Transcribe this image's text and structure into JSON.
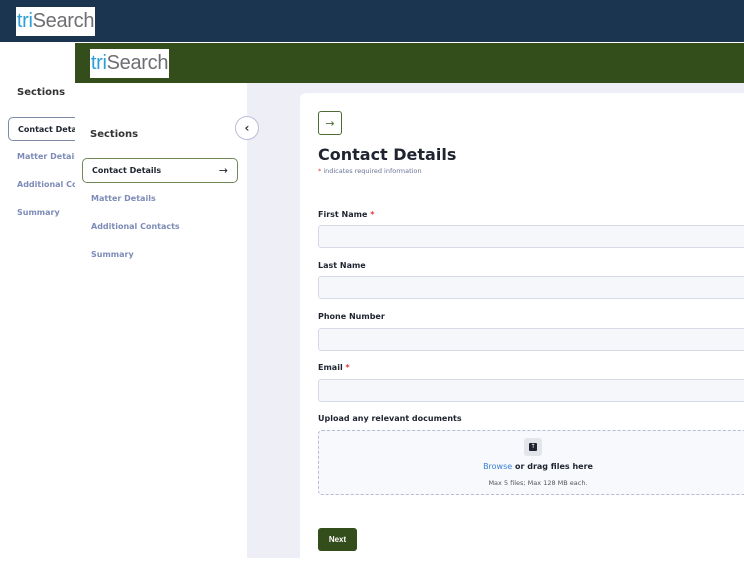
{
  "brand": {
    "logo_tri": "tri",
    "logo_search": "Search",
    "colors": {
      "back_header": "#1b344f",
      "front_header": "#334d1b",
      "accent": "#334d1b"
    }
  },
  "back_sidebar": {
    "title": "Sections",
    "items": [
      {
        "label": "Contact Details",
        "active": true
      },
      {
        "label": "Matter Details"
      },
      {
        "label": "Additional Contacts"
      },
      {
        "label": "Summary"
      }
    ]
  },
  "sidebar": {
    "title": "Sections",
    "items": [
      {
        "label": "Contact Details",
        "active": true,
        "icon": "arrow-right-icon"
      },
      {
        "label": "Matter Details"
      },
      {
        "label": "Additional Contacts"
      },
      {
        "label": "Summary"
      }
    ],
    "arrow": "→",
    "collapse": "‹"
  },
  "form": {
    "step_arrow": "→",
    "title": "Contact Details",
    "required_star": "*",
    "required_note": "indicates required information",
    "fields": [
      {
        "label": "First Name",
        "required": true,
        "value": ""
      },
      {
        "label": "Last Name",
        "required": false,
        "value": ""
      },
      {
        "label": "Phone Number",
        "required": false,
        "value": ""
      },
      {
        "label": "Email",
        "required": true,
        "value": ""
      }
    ],
    "upload": {
      "label": "Upload any relevant documents",
      "browse": "Browse",
      "drag": " or drag files here",
      "limits": "Max 5 files; Max 128 MB each.",
      "icon": "upload-icon"
    },
    "next_label": "Next"
  }
}
